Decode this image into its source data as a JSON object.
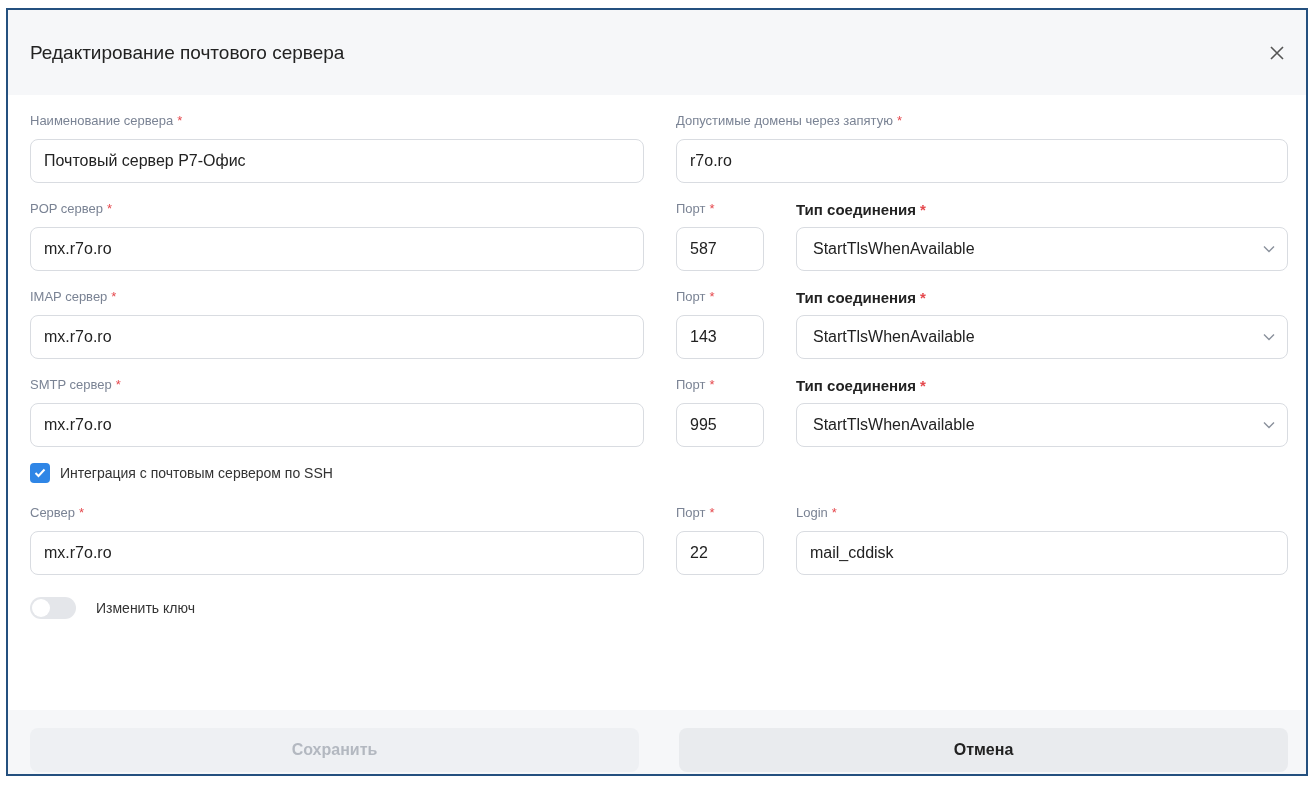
{
  "dialog": {
    "title": "Редактирование почтового сервера"
  },
  "rows": [
    {
      "kind": "fields",
      "fields": [
        {
          "kind": "text",
          "label": "Наименование сервера",
          "mark": "*",
          "emphasized": false,
          "value": "Почтовый сервер Р7-Офис"
        },
        {
          "kind": "text",
          "label": "Допустимые домены через запятую",
          "mark": "*",
          "emphasized": false,
          "value": "r7o.ro"
        }
      ]
    },
    {
      "kind": "fields",
      "fields": [
        {
          "kind": "text",
          "label": "POP сервер",
          "mark": "*",
          "emphasized": false,
          "value": "mx.r7o.ro"
        },
        {
          "kind": "port",
          "label": "Порт",
          "mark": "*",
          "emphasized": false,
          "value": "587"
        },
        {
          "kind": "select",
          "label": "Тип соединения",
          "mark": "*",
          "emphasized": true,
          "value": "StartTlsWhenAvailable"
        }
      ]
    },
    {
      "kind": "fields",
      "fields": [
        {
          "kind": "text",
          "label": "IMAP сервер",
          "mark": "*",
          "emphasized": false,
          "value": "mx.r7o.ro"
        },
        {
          "kind": "port",
          "label": "Порт",
          "mark": "*",
          "emphasized": false,
          "value": "143"
        },
        {
          "kind": "select",
          "label": "Тип соединения",
          "mark": "*",
          "emphasized": true,
          "value": "StartTlsWhenAvailable"
        }
      ]
    },
    {
      "kind": "fields",
      "fields": [
        {
          "kind": "text",
          "label": "SMTP сервер",
          "mark": "*",
          "emphasized": false,
          "value": "mx.r7o.ro"
        },
        {
          "kind": "port",
          "label": "Порт",
          "mark": "*",
          "emphasized": false,
          "value": "995"
        },
        {
          "kind": "select",
          "label": "Тип соединения",
          "mark": "*",
          "emphasized": true,
          "value": "StartTlsWhenAvailable"
        }
      ]
    },
    {
      "kind": "checkbox",
      "label": "Интеграция с почтовым сервером по SSH",
      "checked": true
    },
    {
      "kind": "fields",
      "fields": [
        {
          "kind": "text",
          "label": "Сервер",
          "mark": "*",
          "emphasized": false,
          "value": "mx.r7o.ro"
        },
        {
          "kind": "port",
          "label": "Порт",
          "mark": "*",
          "emphasized": false,
          "value": "22"
        },
        {
          "kind": "text",
          "label": "Login",
          "mark": "*",
          "emphasized": false,
          "value": "mail_cddisk"
        }
      ]
    },
    {
      "kind": "toggle",
      "label": "Изменить ключ",
      "on": false
    }
  ],
  "buttons": [
    {
      "label": "Сохранить",
      "disabled": true
    },
    {
      "label": "Отмена",
      "disabled": false
    }
  ]
}
